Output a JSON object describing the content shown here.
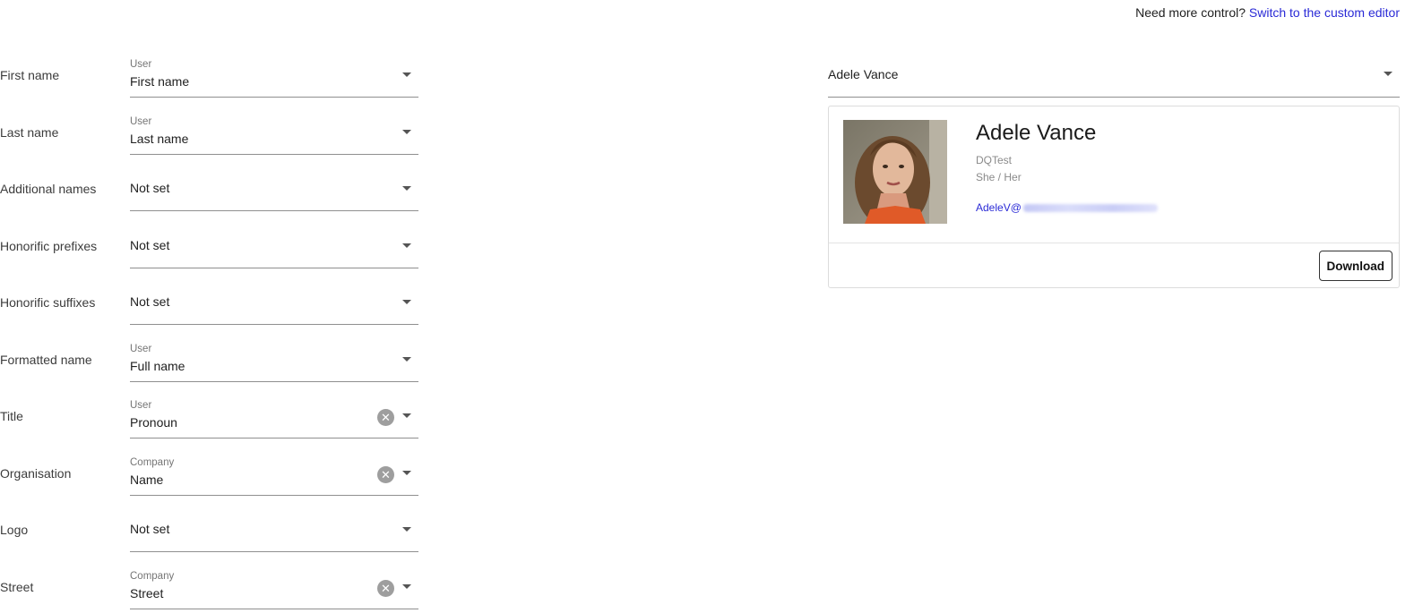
{
  "header": {
    "prompt": "Need more control?",
    "link": "Switch to the custom editor"
  },
  "fields": [
    {
      "label": "First name",
      "caption": "User",
      "value": "First name",
      "clearable": false
    },
    {
      "label": "Last name",
      "caption": "User",
      "value": "Last name",
      "clearable": false
    },
    {
      "label": "Additional names",
      "caption": "",
      "value": "Not set",
      "clearable": false
    },
    {
      "label": "Honorific prefixes",
      "caption": "",
      "value": "Not set",
      "clearable": false
    },
    {
      "label": "Honorific suffixes",
      "caption": "",
      "value": "Not set",
      "clearable": false
    },
    {
      "label": "Formatted name",
      "caption": "User",
      "value": "Full name",
      "clearable": false
    },
    {
      "label": "Title",
      "caption": "User",
      "value": "Pronoun",
      "clearable": true
    },
    {
      "label": "Organisation",
      "caption": "Company",
      "value": "Name",
      "clearable": true
    },
    {
      "label": "Logo",
      "caption": "",
      "value": "Not set",
      "clearable": false
    },
    {
      "label": "Street",
      "caption": "Company",
      "value": "Street",
      "clearable": true
    }
  ],
  "preview": {
    "selected_user": "Adele Vance",
    "card": {
      "name": "Adele Vance",
      "company": "DQTest",
      "pronoun": "She / Her",
      "email_prefix": "AdeleV@",
      "download_label": "Download"
    }
  },
  "icons": {
    "dropdown": "chevron-down-icon",
    "clear": "clear-icon"
  },
  "colors": {
    "link": "#2a2ad6",
    "clear_icon": "#9e9e9e",
    "field_underline": "#8f8f8f"
  }
}
